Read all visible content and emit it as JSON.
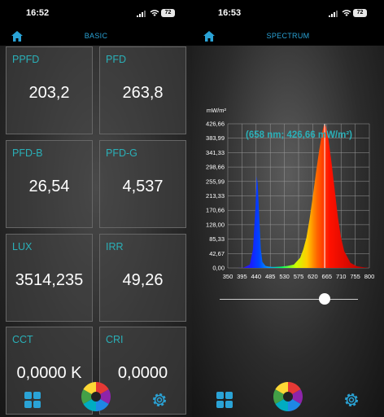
{
  "left_screen": {
    "status": {
      "time": "16:52",
      "battery": "72"
    },
    "nav": {
      "title": "BASIC"
    },
    "cards": [
      {
        "label": "PPFD",
        "value": "203,2"
      },
      {
        "label": "PFD",
        "value": "263,8"
      },
      {
        "label": "PFD-B",
        "value": "26,54"
      },
      {
        "label": "PFD-G",
        "value": "4,537"
      },
      {
        "label": "LUX",
        "value": "3514,235"
      },
      {
        "label": "IRR",
        "value": "49,26"
      },
      {
        "label": "CCT",
        "value": "0,0000 K"
      },
      {
        "label": "CRI",
        "value": "0,0000"
      }
    ]
  },
  "right_screen": {
    "status": {
      "time": "16:53",
      "battery": "72"
    },
    "nav": {
      "title": "SPECTRUM"
    },
    "tooltip": "(658 nm; 426,66 mW/m²)",
    "slider": {
      "value_nm": 658
    }
  },
  "icons": {
    "home": "home-icon",
    "dashboard": "grid-icon",
    "color": "color-wheel-icon",
    "settings": "gear-icon"
  },
  "colors": {
    "accent": "#2aa3d6",
    "label": "#2ab0b8"
  },
  "chart_data": {
    "type": "area",
    "ylabel": "mW/m²",
    "x_ticks": [
      "350",
      "395",
      "440",
      "485",
      "530",
      "575",
      "620",
      "665",
      "710",
      "755",
      "800"
    ],
    "y_ticks": [
      "0,00",
      "42,67",
      "85,33",
      "128,00",
      "170,66",
      "213,33",
      "255,99",
      "298,66",
      "341,33",
      "383,99",
      "426,66"
    ],
    "xlim": [
      350,
      800
    ],
    "ylim": [
      0,
      426.66
    ],
    "grid": true,
    "x": [
      350,
      380,
      400,
      420,
      430,
      438,
      442,
      445,
      450,
      455,
      460,
      470,
      480,
      490,
      500,
      520,
      540,
      560,
      580,
      590,
      600,
      610,
      620,
      630,
      640,
      650,
      655,
      658,
      662,
      670,
      680,
      690,
      700,
      710,
      720,
      740,
      760,
      780,
      800
    ],
    "y": [
      0,
      0,
      1,
      10,
      55,
      180,
      272,
      250,
      150,
      55,
      18,
      6,
      4,
      3,
      3,
      4,
      6,
      10,
      30,
      55,
      90,
      145,
      210,
      280,
      345,
      400,
      420,
      426.66,
      418,
      380,
      310,
      230,
      150,
      90,
      50,
      15,
      5,
      2,
      0
    ],
    "marker_x": 658
  }
}
